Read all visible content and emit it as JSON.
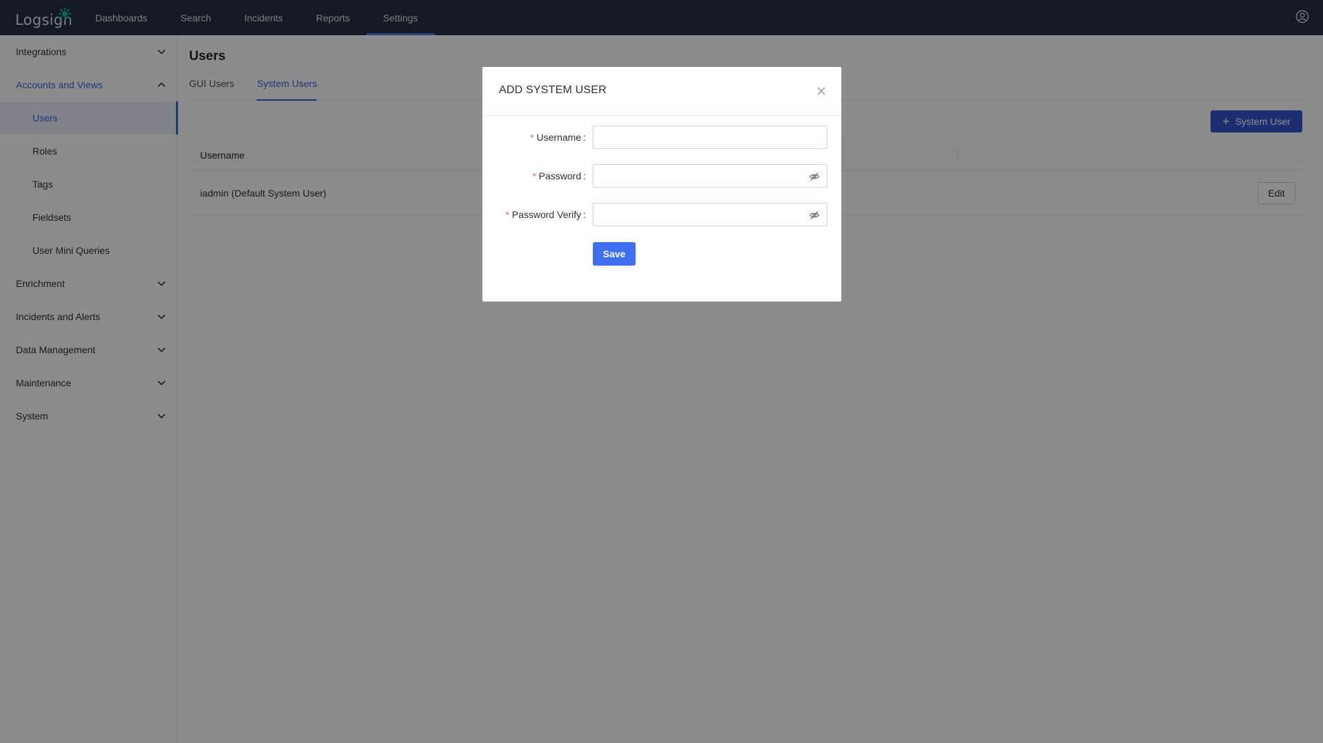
{
  "app": {
    "logo_text": "Logsign",
    "colors": {
      "topbar": "#263040",
      "accent": "#3b63d8",
      "primary_button": "#3e6ff0",
      "required": "#e5484d"
    }
  },
  "nav": {
    "items": [
      {
        "label": "Dashboards",
        "active": false
      },
      {
        "label": "Search",
        "active": false
      },
      {
        "label": "Incidents",
        "active": false
      },
      {
        "label": "Reports",
        "active": false
      },
      {
        "label": "Settings",
        "active": true
      }
    ],
    "user_icon": "user-circle-icon"
  },
  "sidebar": {
    "groups": [
      {
        "label": "Integrations",
        "open": false
      },
      {
        "label": "Accounts and Views",
        "open": true
      },
      {
        "label": "Enrichment",
        "open": false
      },
      {
        "label": "Incidents and Alerts",
        "open": false
      },
      {
        "label": "Data Management",
        "open": false
      },
      {
        "label": "Maintenance",
        "open": false
      },
      {
        "label": "System",
        "open": false
      }
    ],
    "subitems": [
      {
        "label": "Users",
        "active": true
      },
      {
        "label": "Roles",
        "active": false
      },
      {
        "label": "Tags",
        "active": false
      },
      {
        "label": "Fieldsets",
        "active": false
      },
      {
        "label": "User Mini Queries",
        "active": false
      }
    ]
  },
  "main": {
    "title": "Users",
    "tabs": [
      {
        "label": "GUI Users",
        "active": false
      },
      {
        "label": "System Users",
        "active": true
      }
    ],
    "add_button_label": "System User",
    "table": {
      "columns": [
        "Username"
      ],
      "rows": [
        {
          "username": "iadmin (Default System User)",
          "action": "Edit"
        }
      ]
    }
  },
  "modal": {
    "title": "ADD SYSTEM USER",
    "fields": [
      {
        "label": "Username",
        "required": true,
        "value": "",
        "type": "text"
      },
      {
        "label": "Password",
        "required": true,
        "value": "",
        "type": "password"
      },
      {
        "label": "Password Verify",
        "required": true,
        "value": "",
        "type": "password"
      }
    ],
    "required_marker": "*",
    "label_suffix": ":",
    "save_label": "Save"
  }
}
